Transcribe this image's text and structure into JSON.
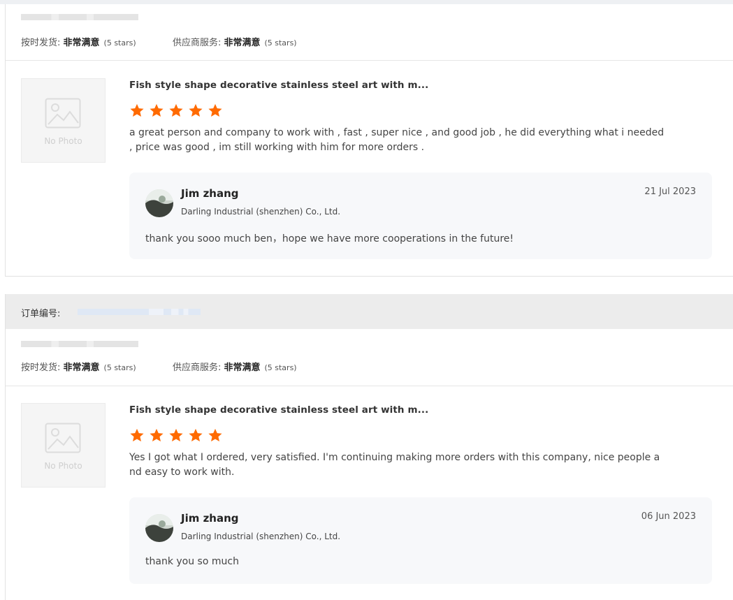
{
  "reviews": [
    {
      "delivery_label": "按时发货: ",
      "delivery_value": "非常满意",
      "delivery_stars": "(5 stars)",
      "service_label": "供应商服务: ",
      "service_value": "非常满意",
      "service_stars": "(5 stars)",
      "photo_placeholder": "No Photo",
      "product_title": "Fish style shape decorative stainless steel art with m...",
      "rating": 5,
      "text_line1": "a great person and company to work with , fast , super nice , and good job , he did everything what i needed",
      "text_line2": ", price was good , im still working with him for more orders .",
      "reply": {
        "name": "Jim zhang",
        "company": "Darling Industrial (shenzhen) Co., Ltd.",
        "date": "21 Jul 2023",
        "text": "thank you sooo much ben，hope we have more cooperations in the future!"
      }
    },
    {
      "order_label": "订单编号:",
      "delivery_label": "按时发货: ",
      "delivery_value": "非常满意",
      "delivery_stars": "(5 stars)",
      "service_label": "供应商服务: ",
      "service_value": "非常满意",
      "service_stars": "(5 stars)",
      "photo_placeholder": "No Photo",
      "product_title": "Fish style shape decorative stainless steel art with m...",
      "rating": 5,
      "text_line1": "Yes I got what I ordered, very satisfied. I'm continuing making more orders with this company, nice people a",
      "text_line2": "nd easy to work with.",
      "reply": {
        "name": "Jim zhang",
        "company": "Darling Industrial (shenzhen) Co., Ltd.",
        "date": "06 Jun 2023",
        "text": "thank you so much"
      }
    }
  ],
  "colors": {
    "star": "#ff6a00",
    "order_bar": "#ececec",
    "reply_bg": "#f7f8fa"
  }
}
